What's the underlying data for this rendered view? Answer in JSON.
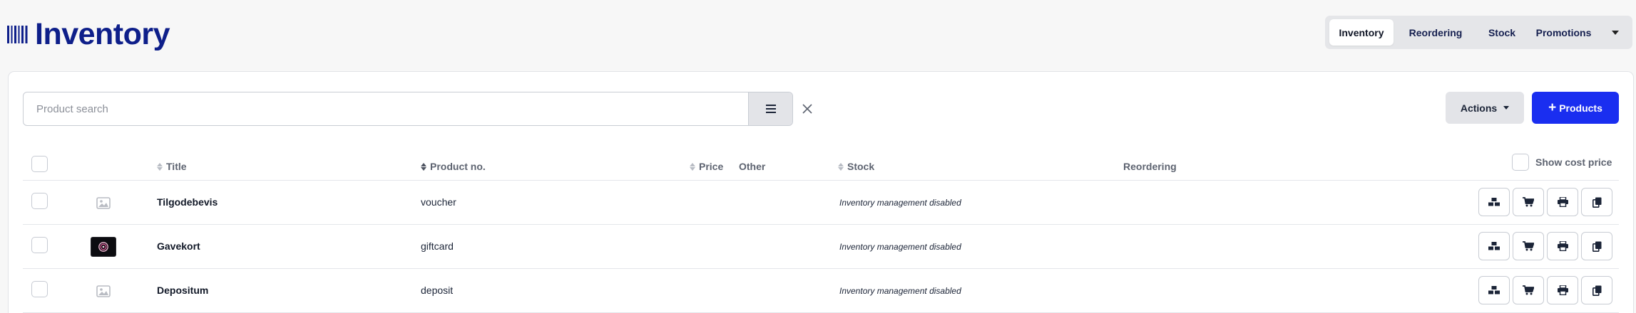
{
  "header": {
    "title": "Inventory",
    "logo_icon": "barcode-icon"
  },
  "nav": {
    "tabs": [
      {
        "label": "Inventory",
        "active": true
      },
      {
        "label": "Reordering",
        "active": false
      },
      {
        "label": "Stock",
        "active": false
      },
      {
        "label": "Promotions",
        "active": false
      }
    ],
    "more_icon": "caret-down-icon"
  },
  "toolbar": {
    "search_placeholder": "Product search",
    "search_value": "",
    "filter_icon": "menu-lines-icon",
    "clear_icon": "close-icon",
    "actions_label": "Actions",
    "add_label": "Products"
  },
  "table": {
    "columns": {
      "title": "Title",
      "product_no": "Product no.",
      "price": "Price",
      "other": "Other",
      "stock": "Stock",
      "reordering": "Reordering"
    },
    "show_cost_label": "Show cost price",
    "rows": [
      {
        "title": "Tilgodebevis",
        "product_no": "voucher",
        "stock": "Inventory management disabled",
        "thumbnail": "image-placeholder-icon"
      },
      {
        "title": "Gavekort",
        "product_no": "giftcard",
        "stock": "Inventory management disabled",
        "thumbnail": "giftcard-image"
      },
      {
        "title": "Depositum",
        "product_no": "deposit",
        "stock": "Inventory management disabled",
        "thumbnail": "image-placeholder-icon"
      }
    ],
    "row_actions": [
      "boxes-icon",
      "cart-icon",
      "print-icon",
      "copy-icon"
    ]
  },
  "colors": {
    "brand": "#0e1f8a",
    "primary_button": "#1a2ef0",
    "background": "#f7f7f7"
  }
}
